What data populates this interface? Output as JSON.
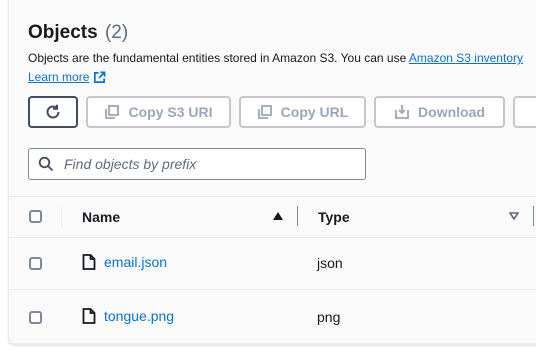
{
  "header": {
    "title": "Objects",
    "count": "(2)",
    "description_prefix": "Objects are the fundamental entities stored in Amazon S3. You can use ",
    "description_link": "Amazon S3 inventory",
    "learn_more": "Learn more"
  },
  "toolbar": {
    "copy_s3_uri": "Copy S3 URI",
    "copy_url": "Copy URL",
    "download": "Download"
  },
  "search": {
    "placeholder": "Find objects by prefix"
  },
  "table": {
    "columns": {
      "name": "Name",
      "type": "Type"
    },
    "rows": [
      {
        "name": "email.json",
        "type": "json"
      },
      {
        "name": "tongue.png",
        "type": "png"
      }
    ]
  },
  "colors": {
    "link": "#0972d3",
    "text": "#16191f",
    "disabled": "#9ba7b6"
  }
}
